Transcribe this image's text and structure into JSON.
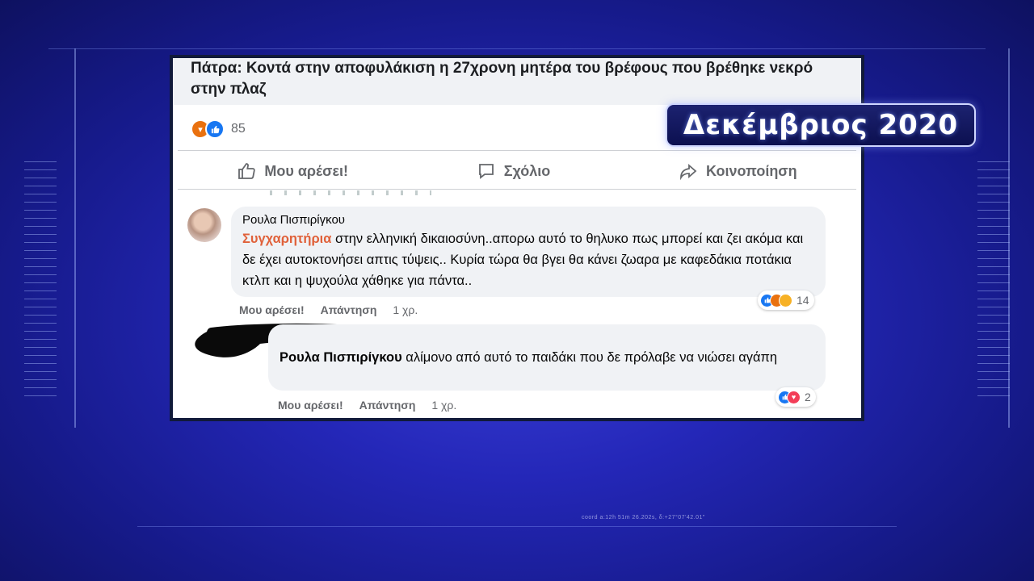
{
  "post": {
    "title": "Πάτρα: Κοντά στην αποφυλάκιση η 27χρονη μητέρα του βρέφους που βρέθηκε νεκρό στην πλαζ",
    "reaction_count": "85",
    "reaction_icons": [
      "angry-icon",
      "like-icon"
    ]
  },
  "actions": {
    "like": "Μου αρέσει!",
    "comment": "Σχόλιο",
    "share": "Κοινοποίηση"
  },
  "comments": [
    {
      "author": "Ρουλα Πισπιρίγκου",
      "highlight": "Συγχαρητήρια",
      "text": " στην ελληνική δικαιοσύνη..απορω αυτό το θηλυκο πως μπορεί και ζει ακόμα και δε έχει αυτοκτονήσει απτις τύψεις.. Κυρία τώρα θα βγει θα κάνει ζωαρα με καφεδάκια ποτάκια κτλπ και η ψυχούλα χάθηκε για πάντα..",
      "like_label": "Μου αρέσει!",
      "reply_label": "Απάντηση",
      "time": "1 χρ.",
      "reaction_count": "14",
      "reaction_icons": [
        "like-icon",
        "angry-icon",
        "sad-icon"
      ]
    },
    {
      "author": "",
      "mention": "Ρουλα Πισπιρίγκου",
      "text": " αλίμονο από αυτό το παιδάκι που δε πρόλαβε να νιώσει αγάπη",
      "like_label": "Μου αρέσει!",
      "reply_label": "Απάντηση",
      "time": "1 χρ.",
      "reaction_count": "2",
      "reaction_icons": [
        "like-icon",
        "love-icon"
      ]
    }
  ],
  "overlay": {
    "date_label": "Δεκέμβριος 2020",
    "coord_text": "coord      a:12h 51m 26.202s, δ:+27°07'42.01\""
  },
  "colors": {
    "background": "#2427b8",
    "facebook_blue": "#1877f2",
    "highlight": "#e0613a"
  }
}
